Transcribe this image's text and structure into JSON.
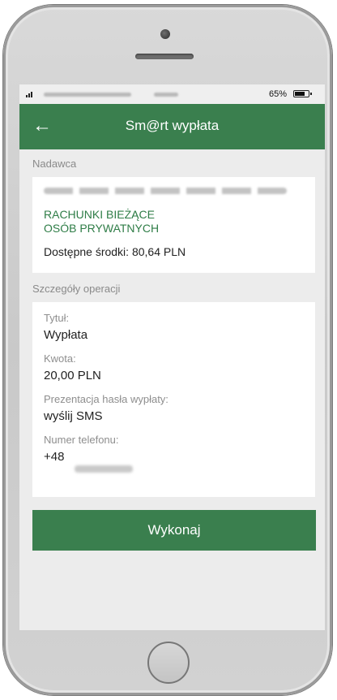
{
  "status_bar": {
    "battery_percent": "65%"
  },
  "app_bar": {
    "title": "Sm@rt wypłata",
    "back_icon": "arrow-left-icon"
  },
  "sender": {
    "section_label": "Nadawca",
    "account_name": "RACHUNKI BIEŻĄCE\nOSÓB PRYWATNYCH",
    "available_funds": "Dostępne środki: 80,64 PLN"
  },
  "details": {
    "section_label": "Szczegóły operacji",
    "fields": [
      {
        "label": "Tytuł:",
        "value": "Wypłata"
      },
      {
        "label": "Kwota:",
        "value": "20,00 PLN"
      },
      {
        "label": "Prezentacja  hasła wypłaty:",
        "value": "wyślij SMS"
      },
      {
        "label": "Numer telefonu:",
        "value": "+48"
      }
    ]
  },
  "actions": {
    "execute_label": "Wykonaj"
  },
  "colors": {
    "brand_green": "#3a7f4e",
    "account_green": "#2f7d47"
  }
}
